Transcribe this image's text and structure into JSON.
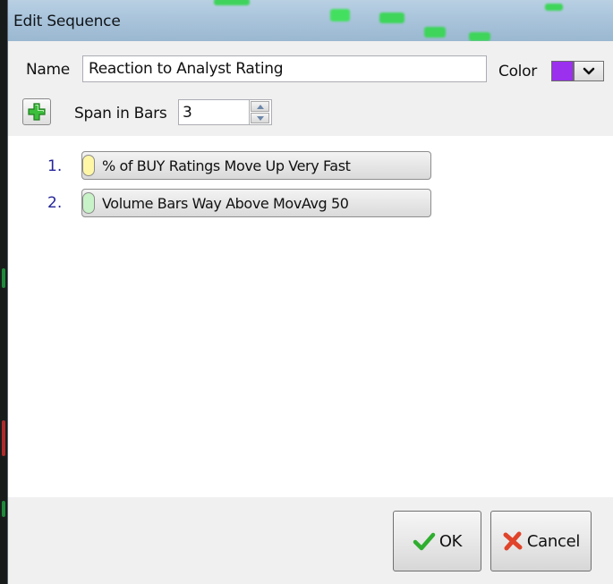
{
  "window": {
    "title": "Edit Sequence"
  },
  "form": {
    "name_label": "Name",
    "name_value": "Reaction to Analyst Rating",
    "color_label": "Color",
    "color_value": "#9b30ef",
    "span_label": "Span in Bars",
    "span_value": "3"
  },
  "items": [
    {
      "number": "1.",
      "label": "% of BUY Ratings Move Up Very Fast",
      "pill_color": "#fff7a6"
    },
    {
      "number": "2.",
      "label": "Volume Bars Way Above MovAvg 50",
      "pill_color": "#c8f3c8"
    }
  ],
  "buttons": {
    "ok_label": "OK",
    "cancel_label": "Cancel"
  },
  "colors": {
    "accent_green": "#2fae2f",
    "cancel_red": "#e0442a",
    "title_bar": "#a9c4db",
    "item_number": "#24249a"
  }
}
